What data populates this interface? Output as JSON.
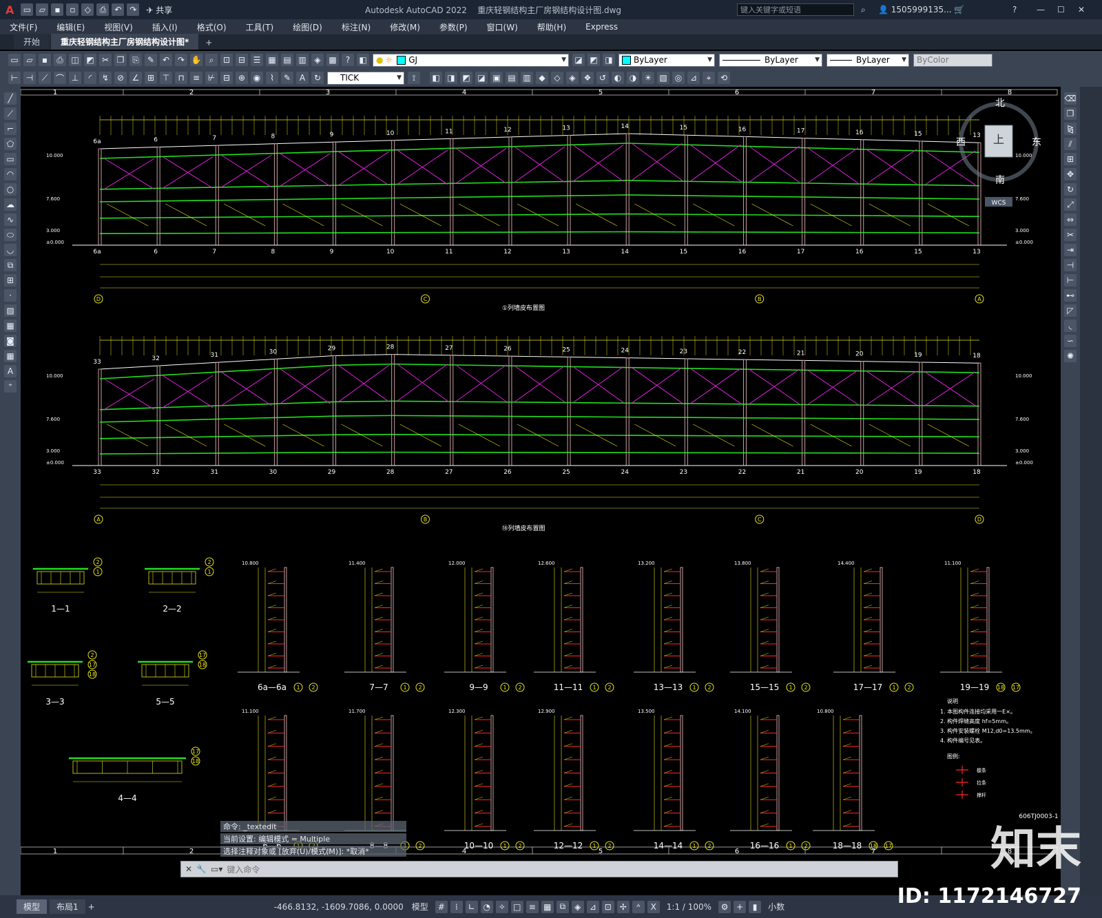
{
  "titlebar": {
    "app_letter": "A",
    "share_label": "共享",
    "title": "Autodesk AutoCAD 2022",
    "filename": "重庆轻钢结构主厂房钢结构设计图.dwg",
    "search_placeholder": "键入关键字或短语",
    "user": "1505999135...",
    "help": "?"
  },
  "menu": [
    "文件(F)",
    "编辑(E)",
    "视图(V)",
    "插入(I)",
    "格式(O)",
    "工具(T)",
    "绘图(D)",
    "标注(N)",
    "修改(M)",
    "参数(P)",
    "窗口(W)",
    "帮助(H)",
    "Express"
  ],
  "tabs": [
    "开始",
    "重庆轻钢结构主厂房钢结构设计图*"
  ],
  "toolbar": {
    "layer": "GJ",
    "color": "ByLayer",
    "linetype": "ByLayer",
    "lineweight": "ByLayer",
    "plotstyle": "ByColor",
    "dimstyle": "TICK"
  },
  "colors": {
    "green": "#22e01e",
    "yellow": "#e8e41a",
    "magenta": "#e020e0",
    "red": "#ff2a2a",
    "white": "#ffffff",
    "column": "#c8a0a0"
  },
  "grid_numbers": [
    "1",
    "2",
    "3",
    "4",
    "5",
    "6",
    "7",
    "8"
  ],
  "viewcube": {
    "north": "北",
    "south": "南",
    "east": "东",
    "west": "西",
    "top": "上",
    "wcs": "WCS"
  },
  "elev1": {
    "caption": "①列墙皮布置图",
    "cols_top": [
      "6a",
      "6",
      "7",
      "8",
      "9",
      "10",
      "11",
      "12",
      "13",
      "14",
      "15",
      "16",
      "17",
      "16",
      "15",
      "13"
    ],
    "cols_bottom": [
      "6a",
      "6",
      "7",
      "8",
      "9",
      "10",
      "11",
      "12",
      "13",
      "14",
      "15",
      "16",
      "17",
      "16",
      "15",
      "13"
    ],
    "axes": [
      "D",
      "C",
      "B",
      "A"
    ],
    "levels": [
      "10.000",
      "7.600",
      "3.000",
      "±0.000"
    ]
  },
  "elev2": {
    "caption": "⑱列墙皮布置图",
    "cols_top": [
      "33",
      "32",
      "31",
      "30",
      "29",
      "28",
      "27",
      "26",
      "25",
      "24",
      "23",
      "22",
      "21",
      "20",
      "19",
      "18"
    ],
    "cols_bottom": [
      "33",
      "32",
      "31",
      "30",
      "29",
      "28",
      "27",
      "26",
      "25",
      "24",
      "23",
      "22",
      "21",
      "20",
      "19",
      "18"
    ],
    "axes": [
      "A",
      "B",
      "C",
      "D"
    ],
    "levels": [
      "10.000",
      "7.600",
      "3.000",
      "±0.000"
    ]
  },
  "sections_small": [
    {
      "label": "1—1",
      "refs": [
        "2",
        "1"
      ]
    },
    {
      "label": "2—2",
      "refs": [
        "2",
        "1"
      ]
    },
    {
      "label": "3—3",
      "refs": [
        "2",
        "17",
        "18"
      ]
    },
    {
      "label": "5—5",
      "refs": [
        "17",
        "18"
      ]
    },
    {
      "label": "4—4",
      "refs": [
        "17",
        "18"
      ]
    }
  ],
  "sections_tall_row1": [
    {
      "label": "6a—6a",
      "refs": [
        "1",
        "2"
      ],
      "top": "10.800"
    },
    {
      "label": "7—7",
      "refs": [
        "1",
        "2"
      ],
      "top": "11.400"
    },
    {
      "label": "9—9",
      "refs": [
        "1",
        "2"
      ],
      "top": "12.000"
    },
    {
      "label": "11—11",
      "refs": [
        "1",
        "2"
      ],
      "top": "12.600"
    },
    {
      "label": "13—13",
      "refs": [
        "1",
        "2"
      ],
      "top": "13.200"
    },
    {
      "label": "15—15",
      "refs": [
        "1",
        "2"
      ],
      "top": "13.800"
    },
    {
      "label": "17—17",
      "refs": [
        "1",
        "2"
      ],
      "top": "14.400"
    },
    {
      "label": "19—19",
      "refs": [
        "18",
        "17"
      ],
      "top": "11.100"
    }
  ],
  "sections_tall_row2": [
    {
      "label": "6—6",
      "refs": [
        "1",
        "2"
      ],
      "top": "11.100"
    },
    {
      "label": "8—8",
      "refs": [
        "1",
        "2"
      ],
      "top": "11.700"
    },
    {
      "label": "10—10",
      "refs": [
        "1",
        "2"
      ],
      "top": "12.300"
    },
    {
      "label": "12—12",
      "refs": [
        "1",
        "2"
      ],
      "top": "12.900"
    },
    {
      "label": "14—14",
      "refs": [
        "1",
        "2"
      ],
      "top": "13.500"
    },
    {
      "label": "16—16",
      "refs": [
        "1",
        "2"
      ],
      "top": "14.100"
    },
    {
      "label": "18—18",
      "refs": [
        "18",
        "17"
      ],
      "top": "10.800"
    }
  ],
  "notes": {
    "title": "说明",
    "items": [
      "1. 本图构件连接均采用一E×。",
      "2. 构件焊缝高度 hf=5mm。",
      "3. 构件安装螺栓 M12,d0=13.5mm。",
      "4. 构件编号见表。"
    ],
    "legend_title": "图例:",
    "legend_items": [
      "檩条",
      "拉条",
      "撑杆"
    ],
    "drawing_no": "606TJ0003-1"
  },
  "command": {
    "history": [
      "命令: _textedit",
      "当前设置: 编辑模式 = Multiple",
      "选择注释对象或 [放弃(U)/模式(M)]: *取消*"
    ],
    "placeholder": "键入命令"
  },
  "layout_tabs": [
    "模型",
    "布局1"
  ],
  "status": {
    "coords": "-466.8132, -1609.7086, 0.0000",
    "mode": "模型",
    "scale": "1:1 / 100%",
    "units": "小数"
  },
  "watermark": {
    "logo": "知末",
    "id": "ID: 1172146727"
  }
}
